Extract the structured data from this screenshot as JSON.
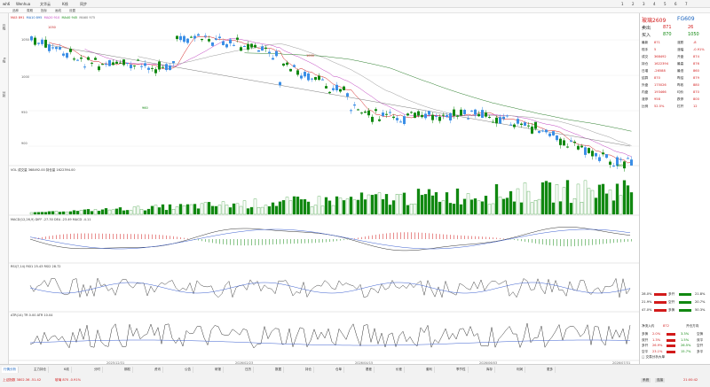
{
  "menubar": {
    "items": [
      "wh6",
      "Wenhua",
      "文华云",
      "K线",
      "同步"
    ],
    "right_items": [
      "1",
      "2",
      "3",
      "4",
      "5",
      "6",
      "7"
    ]
  },
  "toolbar": {
    "items": [
      "品种",
      "周期",
      "指标",
      "画线",
      "设置"
    ]
  },
  "leftbar": {
    "items": [
      "日线",
      "K线",
      "分时"
    ]
  },
  "main_chart": {
    "title_row": [
      "MA5 891",
      "MA10 895",
      "MA20 910",
      "MA40 945",
      "MA60 975"
    ],
    "price_labels": [
      "1050",
      "1000",
      "950",
      "900"
    ],
    "low_label": "880",
    "annotations": [
      "1050",
      "1000",
      "960",
      "880"
    ]
  },
  "volume_pane": {
    "title": "VOL  成交量 368492.00  持仓量 1622394.00"
  },
  "macd_pane": {
    "title": "MACD(12,26,9)  DIFF -27.30  DEA -23.49  MACD -4.11"
  },
  "rsi_pane": {
    "title": "RSI(7,14)  RSI1 25.43  RSI2 28.72"
  },
  "atr_pane": {
    "title": "ATR(14)  TR 0.00  ATR 10.04"
  },
  "xaxis": {
    "ticks": [
      "2025/12/31",
      "2026/02/23",
      "2026/04/15",
      "2026/06/03",
      "2026/07/31"
    ]
  },
  "panel": {
    "contract": "玻璃2609",
    "code": "FG609",
    "quote_rows": [
      {
        "label": "卖出",
        "price": "871",
        "vol": "26"
      },
      {
        "label": "买入",
        "price": "870",
        "vol": "1050"
      }
    ],
    "detail_rows": [
      {
        "k1": "最新",
        "v1": "871",
        "k2": "涨跌",
        "v2": "-8"
      },
      {
        "k1": "现手",
        "v1": "5",
        "k2": "涨幅",
        "v2": "-0.91%"
      },
      {
        "k1": "成交",
        "v1": "368492",
        "k2": "开盘",
        "v2": "874"
      },
      {
        "k1": "持仓",
        "v1": "1622394",
        "k2": "最高",
        "v2": "876"
      },
      {
        "k1": "日增",
        "v1": "-26588",
        "k2": "最低",
        "v2": "860"
      },
      {
        "k1": "结算",
        "v1": "870",
        "k2": "昨结",
        "v2": "879"
      },
      {
        "k1": "外盘",
        "v1": "175026",
        "k2": "昨收",
        "v2": "880"
      },
      {
        "k1": "内盘",
        "v1": "193466",
        "k2": "均价",
        "v2": "870"
      },
      {
        "k1": "涨停",
        "v1": "958",
        "k2": "跌停",
        "v2": "800"
      },
      {
        "k1": "比例",
        "v1": "52.5%",
        "k2": "杠杆",
        "v2": "12"
      }
    ],
    "flow_rows": [
      {
        "l": "28.0%",
        "m": "多开",
        "r": "21.8%"
      },
      {
        "l": "21.9%",
        "m": "空开",
        "r": "20.7%"
      },
      {
        "l": "47.0%",
        "m": "多换",
        "r": "50.3%"
      }
    ],
    "flow_footer": [
      "净流入约",
      "872",
      "开仓方向"
    ],
    "dist_rows": [
      {
        "k": "多换",
        "l": "2.0%",
        "r": "3.3%",
        "k2": "空换"
      },
      {
        "k": "双开",
        "l": "1.3%",
        "r": "1.5%",
        "k2": "双平"
      },
      {
        "k": "多开",
        "l": "26.9%",
        "r": "26.5%",
        "k2": "空开"
      },
      {
        "k": "空平",
        "l": "23.1%",
        "r": "15.7%",
        "k2": "多平"
      }
    ],
    "dist_footer": "□ 交易分析大单"
  },
  "bottombar": {
    "tabs": [
      "行情分析",
      "主力持仓",
      "K线",
      "分时",
      "期权",
      "资讯",
      "公告",
      "研报",
      "日历",
      "数据",
      "持仓",
      "仓单",
      "基差",
      "价差",
      "套利",
      "季节性",
      "库存",
      "利润",
      "更多"
    ],
    "status": {
      "left": "上证指数  3802.36  -51.42",
      "mid": "玻璃  870  -0.91%",
      "right_btn1": "系统",
      "right_btn2": "连接",
      "time": "21:00:42"
    }
  },
  "colors": {
    "up": "#d21a1a",
    "down": "#118811",
    "kline_up_blue": "#3a8ee6",
    "accent": "#1560bd"
  }
}
